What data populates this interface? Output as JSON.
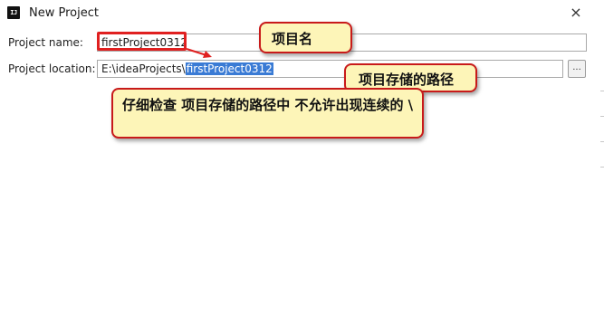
{
  "window": {
    "title": "New Project",
    "icon_text": "IJ",
    "close_symbol": "×"
  },
  "form": {
    "project_name_label": "Project name:",
    "project_name_value": "firstProject0312",
    "project_location_label": "Project location:",
    "project_location_prefix": "E:\\ideaProjects\\",
    "project_location_selected": "firstProject0312",
    "browse_label": "..."
  },
  "annotations": {
    "name_callout": "项目名",
    "path_callout": "项目存储的路径",
    "warning_callout": "仔细检查 项目存储的路径中 不允许出现连续的 \\"
  },
  "colors": {
    "highlight_border": "#e02020",
    "callout_fill": "#fdf5b8",
    "callout_border": "#c81a1a",
    "selection": "#3a7bd5"
  }
}
